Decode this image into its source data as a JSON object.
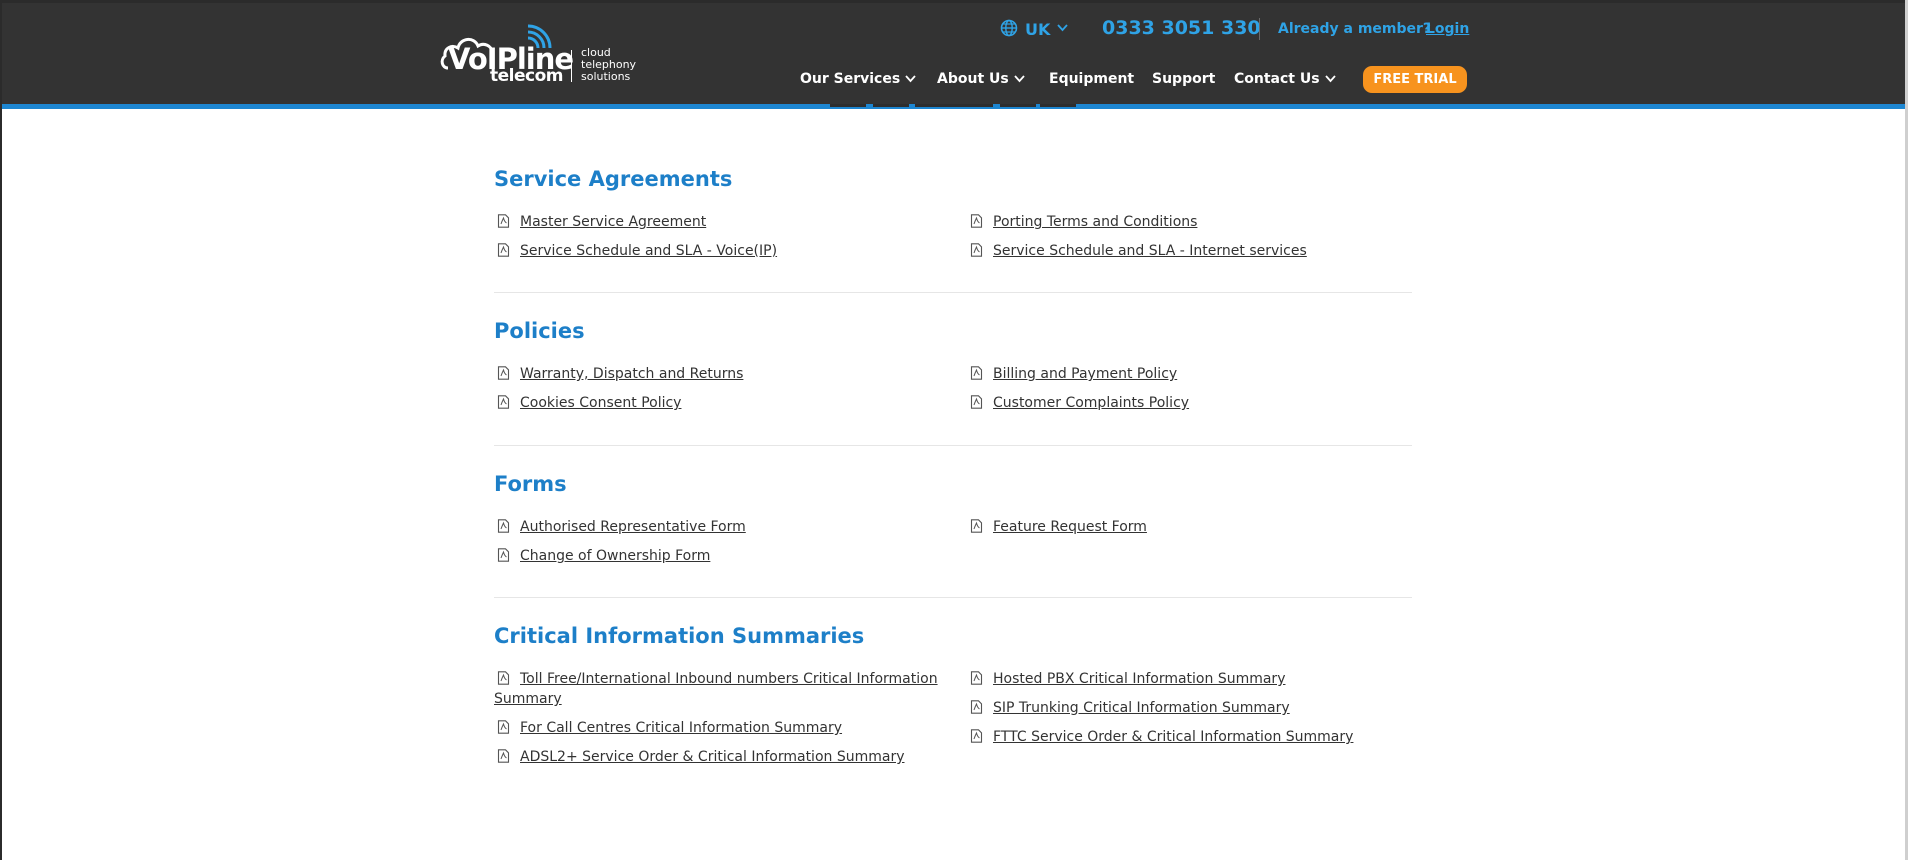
{
  "header": {
    "logo": {
      "brand": "VoIPline",
      "sub": "telecom",
      "tagline": [
        "cloud",
        "telephony",
        "solutions"
      ]
    },
    "region": "UK",
    "phone": "0333 3051 330",
    "member_text": "Already a member?",
    "login_label": "Login",
    "nav": [
      "Our Services",
      "About Us",
      "Equipment",
      "Support",
      "Contact Us"
    ],
    "cta_label": "FREE TRIAL"
  },
  "colors": {
    "header_bg": "#333333",
    "accent_blue": "#1d86d1",
    "link_blue": "#2fa3e6",
    "cta_orange": "#f7931e",
    "heading_blue": "#1d7fc8"
  },
  "sections": [
    {
      "title": "Service Agreements",
      "left": [
        "Master Service Agreement",
        "Service Schedule and SLA - Voice(IP)"
      ],
      "right": [
        "Porting Terms and Conditions",
        "Service Schedule and SLA - Internet services"
      ]
    },
    {
      "title": "Policies",
      "left": [
        "Warranty, Dispatch and Returns",
        "Cookies Consent Policy"
      ],
      "right": [
        "Billing and Payment Policy",
        "Customer Complaints Policy"
      ]
    },
    {
      "title": "Forms",
      "left": [
        "Authorised Representative Form",
        "Change of Ownership Form"
      ],
      "right": [
        "Feature Request Form"
      ]
    },
    {
      "title": "Critical Information Summaries",
      "left": [
        "Toll Free/International Inbound numbers Critical Information Summary",
        "For Call Centres Critical Information Summary",
        "ADSL2+ Service Order & Critical Information Summary"
      ],
      "right": [
        "Hosted PBX Critical Information Summary",
        "SIP Trunking Critical Information Summary",
        "FTTC Service Order & Critical Information Summary"
      ]
    }
  ]
}
